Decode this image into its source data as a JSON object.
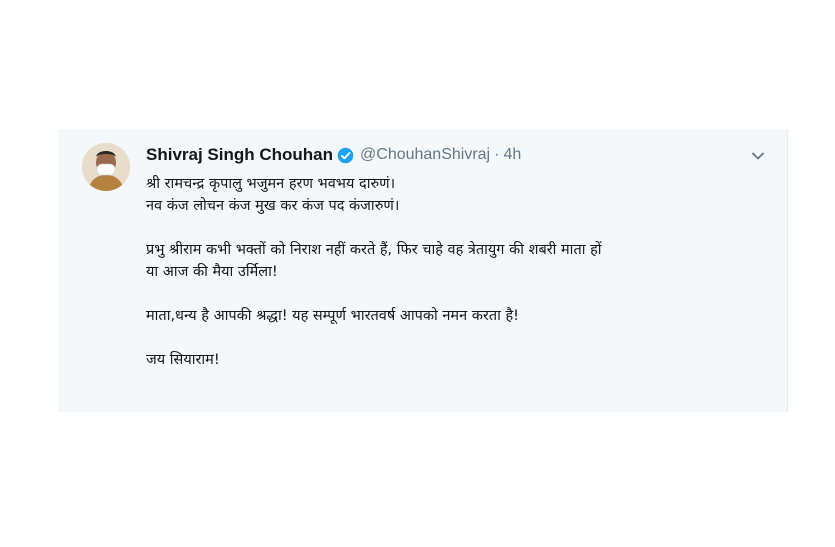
{
  "tweet": {
    "author": {
      "name": "Shivraj Singh Chouhan",
      "handle": "@ChouhanShivraj",
      "separator": "·",
      "time": "4h",
      "verified": true
    },
    "lines": {
      "l1": "श्री रामचन्द्र कृपालु भजुमन हरण भवभय दारुणं।",
      "l2": "नव कंज लोचन कंज मुख कर कंज पद कंजारुणं।",
      "l3": "प्रभु श्रीराम कभी भक्तों को निराश नहीं करते हैं, फिर चाहे वह त्रेतायुग की शबरी माता हों",
      "l4": "या आज की मैया उर्मिला!",
      "l5": "माता,धन्य है आपकी श्रद्धा! यह सम्पूर्ण भारतवर्ष आपको नमन करता है!",
      "l6": "जय सियाराम!"
    },
    "icons": {
      "verified": "verified-badge-icon",
      "menu": "chevron-down-icon",
      "avatar": "profile-photo"
    },
    "colors": {
      "card_bg": "#f5f8fa",
      "verified": "#1da1f2",
      "secondary_text": "#657786"
    }
  }
}
